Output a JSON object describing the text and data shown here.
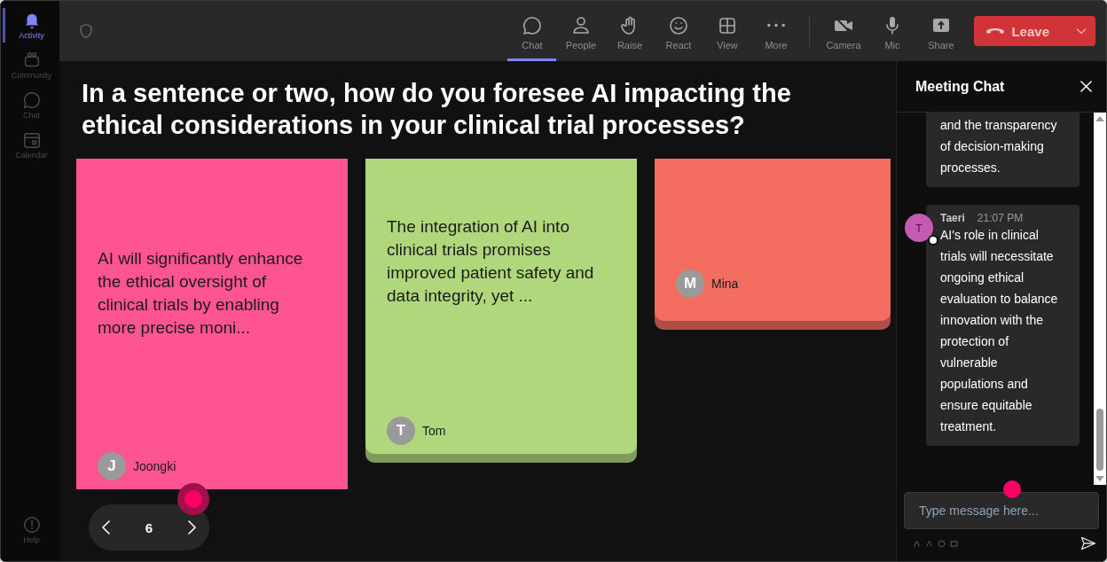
{
  "sidebar": {
    "items": [
      {
        "label": "Activity",
        "selected": true
      },
      {
        "label": "Community",
        "selected": false
      },
      {
        "label": "Chat",
        "selected": false
      },
      {
        "label": "Calendar",
        "selected": false
      }
    ],
    "help": {
      "label": "Help"
    }
  },
  "toolbar": {
    "items": [
      {
        "label": "Chat",
        "selected": true
      },
      {
        "label": "People",
        "selected": false
      },
      {
        "label": "Raise",
        "selected": false
      },
      {
        "label": "React",
        "selected": false
      },
      {
        "label": "View",
        "selected": false
      },
      {
        "label": "More",
        "selected": false
      },
      {
        "label": "Camera",
        "selected": false
      },
      {
        "label": "Mic",
        "selected": false
      },
      {
        "label": "Share",
        "selected": false
      }
    ],
    "leave_button": {
      "label": "Leave"
    }
  },
  "question": "In a sentence or two, how do you foresee AI impacting the ethical considerations in your clinical trial processes?",
  "cards": [
    {
      "text": "AI will significantly enhance the ethical oversight of clinical trials by enabling more precise moni...",
      "author": "Joongki",
      "initial": "J",
      "color": "#ff5494"
    },
    {
      "text": "The integration of AI into clinical trials promises improved patient safety and data integrity, yet ...",
      "author": "Tom",
      "initial": "T",
      "color": "#b0d77b"
    },
    {
      "author": "Mina",
      "initial": "M",
      "color": "#f36d60"
    }
  ],
  "pager": {
    "page": "6"
  },
  "chat": {
    "title": "Meeting Chat",
    "messages": [
      {
        "text": "and the transparency of decision-making processes."
      },
      {
        "author": "Taeri",
        "time": "21:07 PM",
        "initial": "T",
        "text": "AI's role in clinical trials will necessitate ongoing ethical evaluation to balance innovation with the protection of vulnerable populations and ensure equitable treatment."
      }
    ],
    "input": {
      "placeholder": "Type message here..."
    }
  }
}
